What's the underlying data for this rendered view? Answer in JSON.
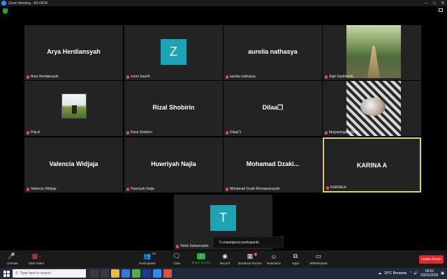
{
  "window": {
    "title": "Zoom Meeting - All-VIEW"
  },
  "tiles": [
    {
      "display_name": "Arya Herdiansyah",
      "label": "Arya Herdiansyah"
    },
    {
      "display_name": "Z",
      "label": "zoom baa04"
    },
    {
      "display_name": "aurelia nathasya",
      "label": "aurelia nathasya"
    },
    {
      "display_name": "",
      "label": "Sigit Septhianto"
    },
    {
      "display_name": "",
      "label": "Pita A"
    },
    {
      "display_name": "Rizal Shobirin",
      "label": "Rizal Shobirin"
    },
    {
      "display_name": "Dilaa❒",
      "label": "Dilaa❒"
    },
    {
      "display_name": "",
      "label": "Mulyaningsih Dzilis"
    },
    {
      "display_name": "Valencia Widjaja",
      "label": "Valencia Widjaja"
    },
    {
      "display_name": "Huwriyah Najla",
      "label": "Huwriyah Najla"
    },
    {
      "display_name": "Mohamad  Dzaki...",
      "label": "Mohamad Dzaki Rizmawansyah"
    },
    {
      "display_name": "KARINA A",
      "label": "KARINA A"
    },
    {
      "display_name": "T",
      "label": "Totok Suharmanto"
    }
  ],
  "unassigned_text": "5 unassigned participants",
  "toolbar": {
    "unmute": "Unmute",
    "start_video": "Start Video",
    "participants": "Participants",
    "participants_count": "13",
    "chat": "Chat",
    "share_screen": "Share Screen",
    "record": "Record",
    "breakout_rooms": "Breakout Rooms",
    "breakout_badge": "5",
    "reactions": "Reactions",
    "apps": "Apps",
    "whiteboards": "Whiteboards",
    "leave": "Leave Room"
  },
  "taskbar": {
    "search_placeholder": "Type here to search",
    "weather": "29°C  Berawan",
    "time": "18:52",
    "date": "03/31/2023"
  },
  "colors": {
    "active_speaker_border": "#d8d85a",
    "avatar_bg": "#1ca3b5",
    "leave_button": "#e02828",
    "share_green": "#2ead4a"
  }
}
